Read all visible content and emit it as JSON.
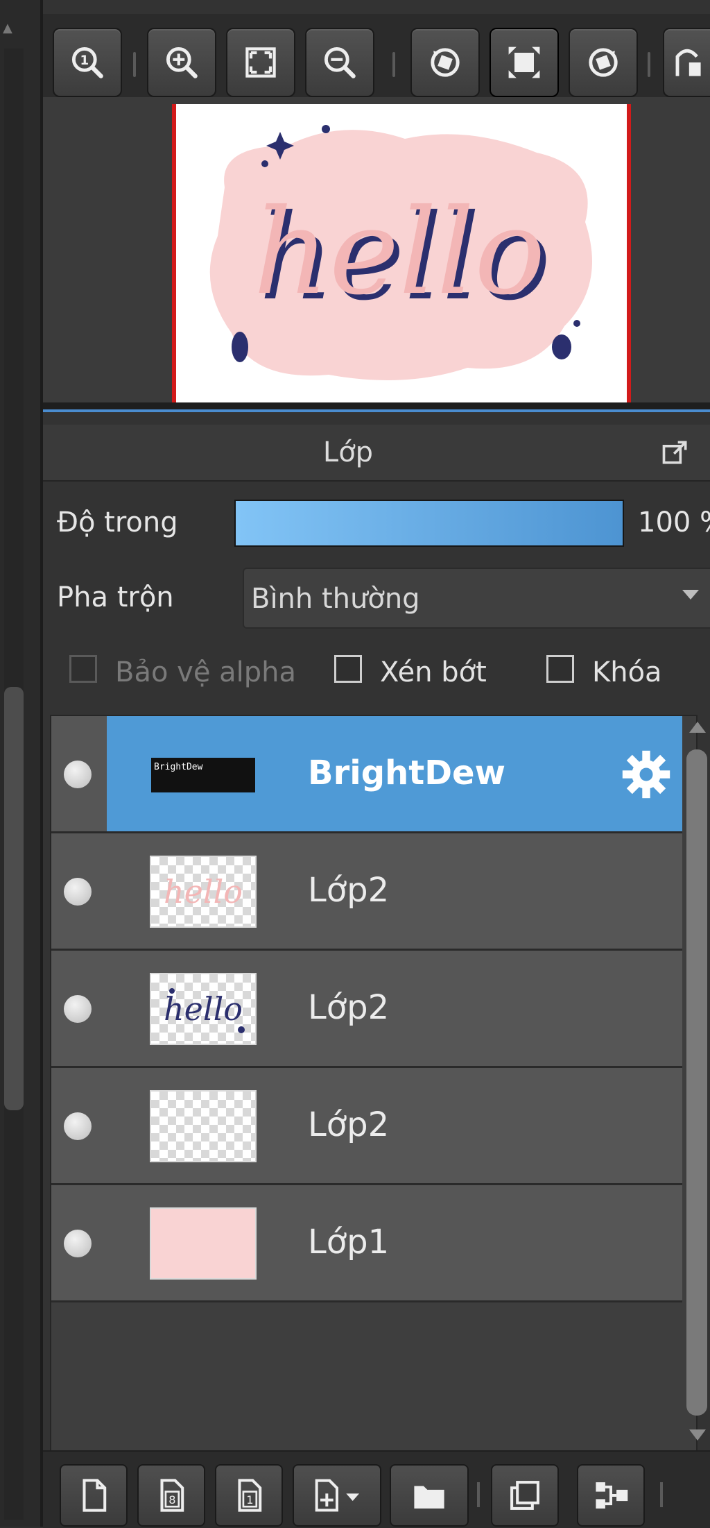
{
  "navigator": {
    "tools": [
      "zoom-actual-icon",
      "zoom-in-icon",
      "fit-screen-icon",
      "zoom-out-icon",
      "rotate-left-icon",
      "fit-canvas-icon",
      "rotate-right-icon",
      "flip-icon"
    ],
    "preview_text": "hello"
  },
  "layer_panel": {
    "title": "Lớp",
    "opacity_label": "Độ trong",
    "opacity_value": "100 %",
    "opacity_fraction": 1.0,
    "blend_label": "Pha trộn",
    "blend_value": "Bình thường",
    "protect_alpha_label": "Bảo vệ alpha",
    "clipping_label": "Xén bớt",
    "lock_label": "Khóa",
    "layers": [
      {
        "name": "BrightDew",
        "selected": true,
        "thumb_text": "BrightDew"
      },
      {
        "name": "Lớp2",
        "selected": false,
        "thumb_text": "hello"
      },
      {
        "name": "Lớp2",
        "selected": false,
        "thumb_text": "hello"
      },
      {
        "name": "Lớp2",
        "selected": false,
        "thumb_text": ""
      },
      {
        "name": "Lớp1",
        "selected": false,
        "thumb_text": ""
      }
    ]
  },
  "colors": {
    "selected": "#4f9ad6",
    "accent_red": "#d21a1a",
    "pink": "#f9d3d3",
    "navy": "#2b2f6e"
  },
  "bottom_tools": [
    "new-layer-icon",
    "new-8bit-layer-icon",
    "new-1bit-layer-icon",
    "add-layer-menu-icon",
    "new-folder-icon",
    "duplicate-layer-icon",
    "merge-layer-icon"
  ]
}
